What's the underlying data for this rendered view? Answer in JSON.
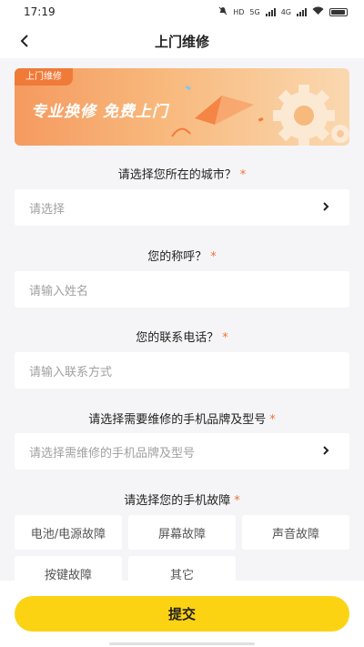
{
  "status_bar": {
    "time": "17:19",
    "net_hd": "HD",
    "net_5g": "5G",
    "net_4g": "4G"
  },
  "nav": {
    "title": "上门维修"
  },
  "banner": {
    "tag": "上门维修",
    "slogan": "专业换修  免费上门"
  },
  "form": {
    "city": {
      "label": "请选择您所在的城市？",
      "placeholder": "请选择"
    },
    "name": {
      "label": "您的称呼？",
      "placeholder": "请输入姓名"
    },
    "phone": {
      "label": "您的联系电话？",
      "placeholder": "请输入联系方式"
    },
    "model": {
      "label": "请选择需要维修的手机品牌及型号",
      "placeholder": "请选择需维修的手机品牌及型号"
    },
    "fault": {
      "label": "请选择您的手机故障",
      "options": [
        "电池/电源故障",
        "屏幕故障",
        "声音故障",
        "按键故障",
        "其它"
      ]
    },
    "required_mark": "*"
  },
  "submit": {
    "label": "提交"
  },
  "colors": {
    "accent": "#fbd313",
    "required": "#f0733a",
    "banner_tag": "#f07a38"
  }
}
